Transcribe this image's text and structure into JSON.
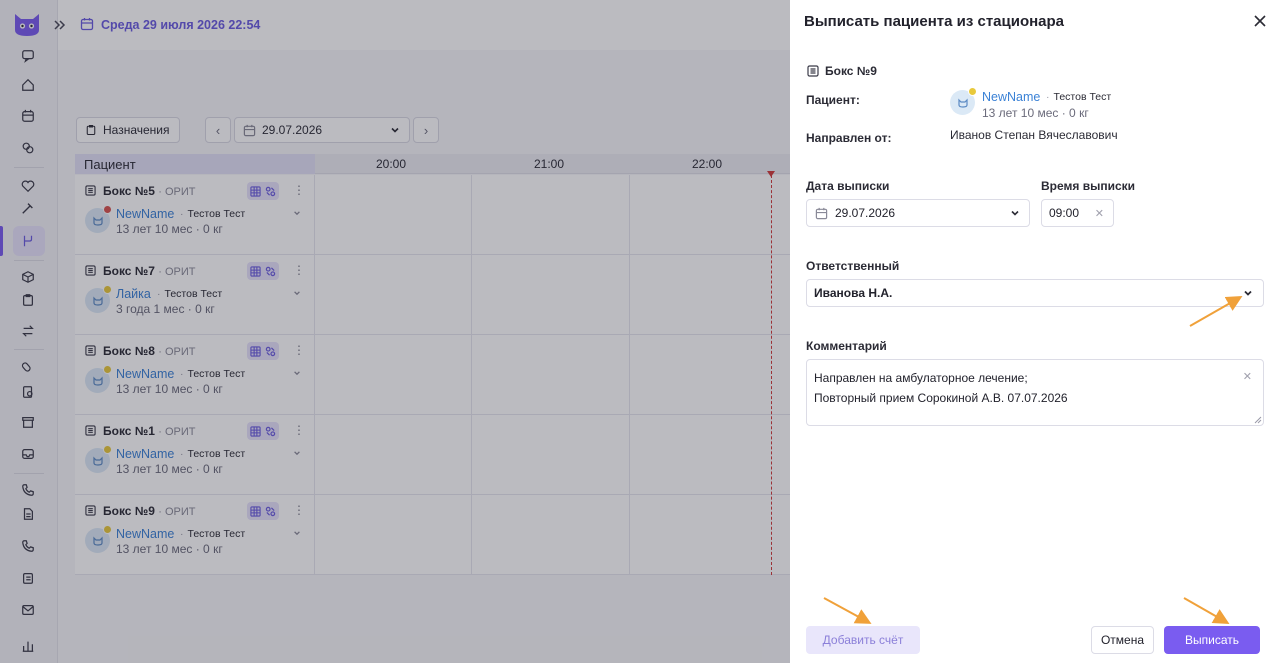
{
  "topbar": {
    "date_text": "Среда 29 июля 2026 22:54"
  },
  "toolbar": {
    "appointments_label": "Назначения",
    "date_value": "29.07.2026",
    "prev_glyph": "‹",
    "next_glyph": "›"
  },
  "grid": {
    "patient_header": "Пациент",
    "times": [
      "20:00",
      "21:00",
      "22:00"
    ],
    "rows": [
      {
        "box": "Бокс №5",
        "dept": "· ОРИТ",
        "pet": "NewName",
        "owner": "Тестов Тест",
        "age": "13 лет 10 мес · 0 кг",
        "status_color": "#d9534f"
      },
      {
        "box": "Бокс №7",
        "dept": "· ОРИТ",
        "pet": "Лайка",
        "owner": "Тестов Тест",
        "age": "3 года 1 мес · 0 кг",
        "status_color": "#e8c93c"
      },
      {
        "box": "Бокс №8",
        "dept": "· ОРИТ",
        "pet": "NewName",
        "owner": "Тестов Тест",
        "age": "13 лет 10 мес · 0 кг",
        "status_color": "#e8c93c"
      },
      {
        "box": "Бокс №1",
        "dept": "· ОРИТ",
        "pet": "NewName",
        "owner": "Тестов Тест",
        "age": "13 лет 10 мес · 0 кг",
        "status_color": "#e8c93c"
      },
      {
        "box": "Бокс №9",
        "dept": "· ОРИТ",
        "pet": "NewName",
        "owner": "Тестов Тест",
        "age": "13 лет 10 мес · 0 кг",
        "status_color": "#e8c93c"
      }
    ]
  },
  "drawer": {
    "title": "Выписать пациента из стационара",
    "box": "Бокс №9",
    "patient_label": "Пациент:",
    "patient": {
      "pet": "NewName",
      "owner": "Тестов Тест",
      "age": "13 лет 10 мес · 0 кг"
    },
    "referred_label": "Направлен от:",
    "referred_value": "Иванов Степан Вячеславович",
    "discharge_date_label": "Дата выписки",
    "discharge_date_value": "29.07.2026",
    "discharge_time_label": "Время выписки",
    "discharge_time_value": "09:00",
    "responsible_label": "Ответственный",
    "responsible_value": "Иванова Н.А.",
    "comment_label": "Комментарий",
    "comment_line1": "Направлен на амбулаторное лечение;",
    "comment_line2": "Повторный прием Сорокиной А.В. 07.07.2026",
    "add_bill_label": "Добавить счёт",
    "cancel_label": "Отмена",
    "submit_label": "Выписать"
  },
  "colors": {
    "accent": "#7a5cf0",
    "link": "#3b82d6",
    "annotation_arrow": "#f0a13a",
    "now_line": "#d13b3b"
  }
}
